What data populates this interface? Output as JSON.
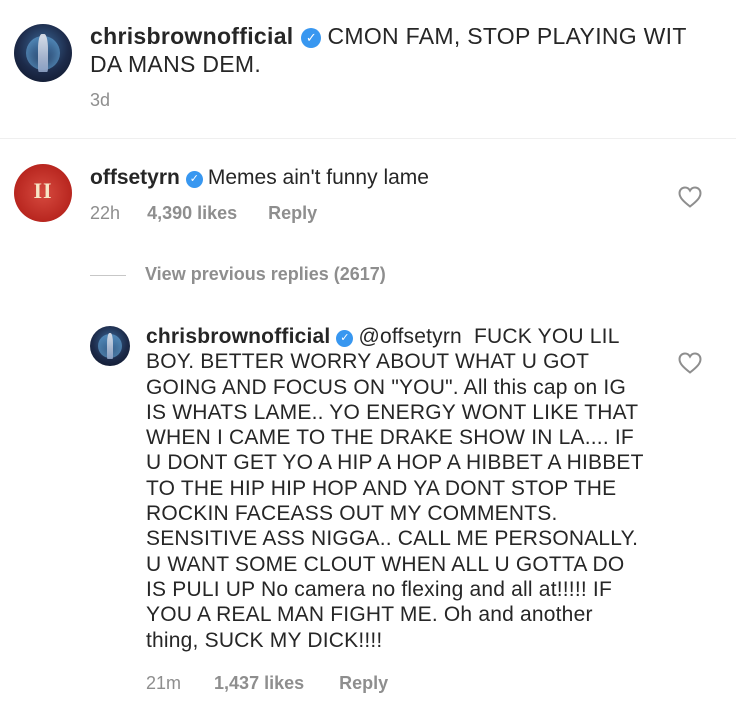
{
  "post": {
    "username": "chrisbrownofficial",
    "caption": "CMON FAM, STOP PLAYING WIT DA MANS DEM.",
    "time": "3d"
  },
  "comment": {
    "username": "offsetyrn",
    "text": "Memes ain't funny lame",
    "time": "22h",
    "likes": "4,390 likes",
    "reply_label": "Reply"
  },
  "view_replies": {
    "label": "View previous replies (2617)"
  },
  "reply": {
    "username": "chrisbrownofficial",
    "mention": "@offsetyrn",
    "text": "FUCK YOU LIL BOY. BETTER WORRY ABOUT WHAT U GOT GOING AND FOCUS ON \"YOU\". All this cap on IG IS WHATS LAME.. YO ENERGY WONT LIKE THAT WHEN I CAME TO THE DRAKE SHOW IN LA.... IF U DONT  GET YO A HIP A HOP A HIBBET A HIBBET TO THE HIP HIP HOP AND YA DONT STOP THE ROCKIN  FACEASS OUT MY COMMENTS. SENSITIVE ASS NIGGA.. CALL ME PERSONALLY. U WANT SOME CLOUT WHEN ALL U GOTTA DO IS PULI UP No camera no flexing and all at!!!!! IF YOU A REAL MAN FIGHT ME. Oh and another thing,  SUCK MY DICK!!!!",
    "time": "21m",
    "likes": "1,437 likes",
    "reply_label": "Reply"
  },
  "icons": {
    "verified": "verified-badge-icon",
    "heart": "heart-outline-icon"
  },
  "colors": {
    "verified": "#3897f0",
    "meta": "#8e8e8e",
    "text": "#262626"
  }
}
